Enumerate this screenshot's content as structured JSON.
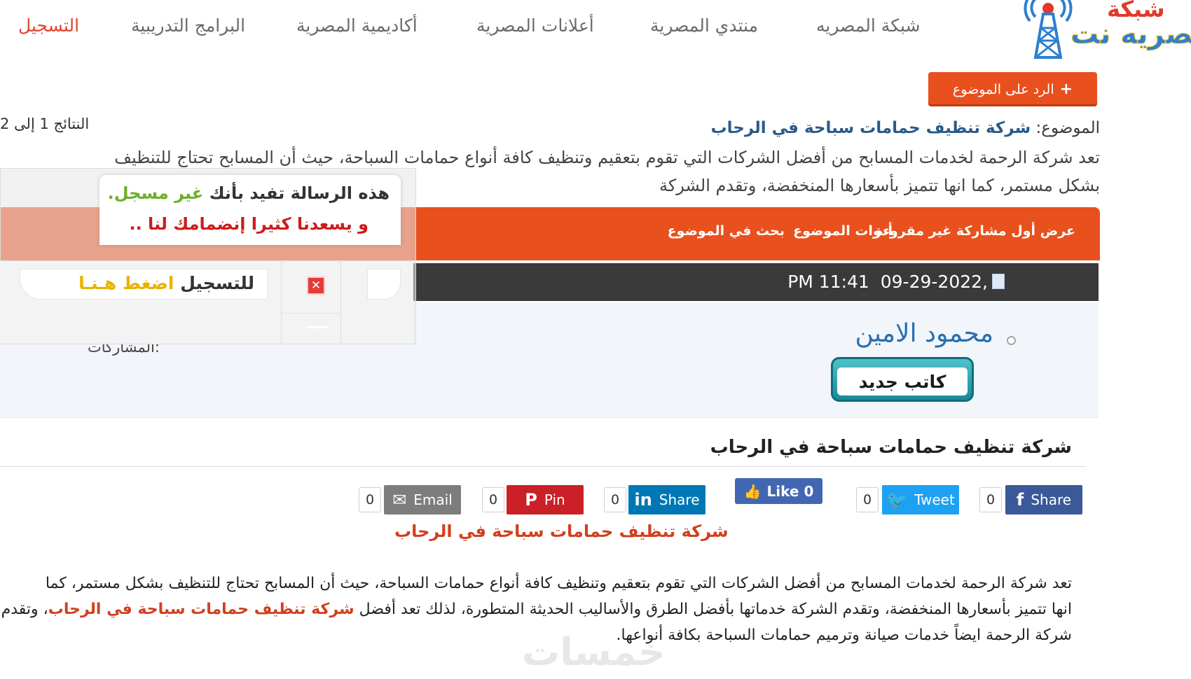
{
  "nav": {
    "register": "التسجيل",
    "training": "البرامج التدريبية",
    "academy": "أكاديمية المصرية",
    "ads": "أعلانات المصرية",
    "forum": "منتدي المصرية",
    "network": "شبكة المصريه"
  },
  "logo": {
    "line1": "شبكة",
    "line2": "مصريه نت"
  },
  "reply_button": "الرد على الموضوع",
  "results": "النتائج 1 إلى 2",
  "topic": {
    "label": "الموضوع:",
    "title": "شركة تنظيف حمامات سباحة في الرحاب"
  },
  "intro": {
    "line1": "تعد شركة الرحمة لخدمات المسابح من أفضل الشركات التي تقوم بتعقيم وتنظيف كافة أنواع حمامات السباحة، حيث أن المسابح تحتاج للتنظيف",
    "line2": "بشكل مستمر، كما انها تتميز بأسعارها المنخفضة، وتقدم الشركة"
  },
  "tools": {
    "first_unread": "عرض أول مشاركة غير مقروءة",
    "thread_tools": "أدوات الموضوع",
    "search_thread": "بحث في الموضوع"
  },
  "post": {
    "date": "09-29-2022,",
    "time": "PM 11:41",
    "username": "محمود الامين",
    "rank": "كاتب جديد",
    "posts_label": "المشاركات:",
    "title": "شركة تنظيف حمامات سباحة في الرحاب"
  },
  "share": {
    "facebook": "Share",
    "facebook_count": "0",
    "twitter": "Tweet",
    "twitter_count": "0",
    "like": "Like 0",
    "linkedin": "Share",
    "linkedin_count": "0",
    "pinterest": "Pin",
    "pinterest_count": "0",
    "email": "Email",
    "email_count": "0"
  },
  "colors": {
    "accent_orange": "#e8501e",
    "facebook": "#3b5998",
    "twitter": "#1da1f2",
    "linkedin": "#0077b5",
    "pinterest": "#cb2027",
    "email": "#7d7d7d"
  },
  "content": {
    "red_title": "شركة تنظيف حمامات سباحة في الرحاب",
    "line1": "تعد شركة الرحمة لخدمات المسابح من أفضل الشركات التي تقوم بتعقيم وتنظيف كافة أنواع حمامات السباحة، حيث أن المسابح تحتاج للتنظيف بشكل مستمر، كما",
    "line2_a": "انها تتميز بأسعارها المنخفضة، وتقدم الشركة خدماتها بأفضل الطرق والأساليب الحديثة المتطورة، لذلك تعد أفضل",
    "line2_link": "شركة تنظيف حمامات سباحة في الرحاب",
    "line2_b": "، وتقدم",
    "line3": "شركة الرحمة ايضاً خدمات صيانة وترميم حمامات السباحة بكافة أنواعها."
  },
  "watermark": "خمسات",
  "popup": {
    "line1_a": "هذه الرسالة تفيد بأنك",
    "line1_b": "غير مسجل.",
    "line2": "و يسعدنا كثيرا إنضمامك لنا ..",
    "register_a": "للتسجيل",
    "register_b": "اضغط هـنـا",
    "close": "✕"
  }
}
